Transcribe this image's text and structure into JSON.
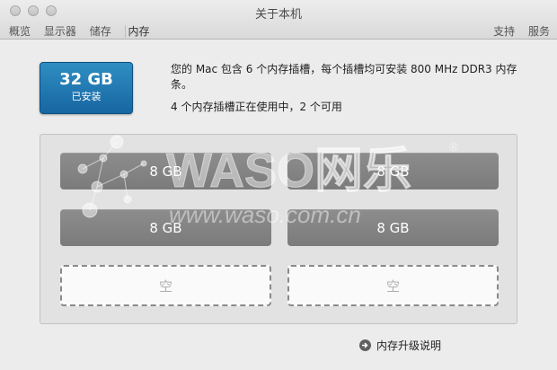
{
  "window": {
    "title": "关于本机",
    "tabs": [
      "概览",
      "显示器",
      "储存",
      "内存"
    ],
    "right_tabs": [
      "支持",
      "服务"
    ]
  },
  "memory": {
    "badge_size": "32 GB",
    "badge_label": "已安装",
    "description": "您的 Mac 包含 6 个内存插槽，每个插槽均可安装 800 MHz DDR3 内存条。",
    "usage": "4 个内存插槽正在使用中，2 个可用",
    "slots": [
      "8 GB",
      "8 GB",
      "8 GB",
      "8 GB",
      "空",
      "空"
    ]
  },
  "help_link": "内存升级说明",
  "watermark": {
    "brand": "WASO网乐",
    "registered": "®",
    "url": "www.waso.com.cn"
  }
}
